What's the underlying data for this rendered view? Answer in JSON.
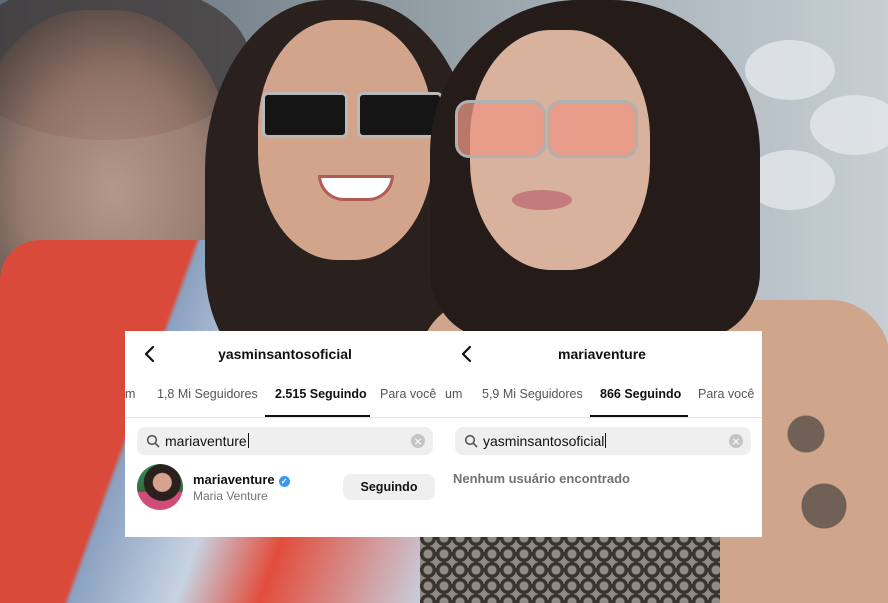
{
  "left_panel": {
    "username": "yasminsantosoficial",
    "tabs": [
      "m",
      "1,8 Mi Seguidores",
      "2.515 Seguindo",
      "Para você"
    ],
    "search_value": "mariaventure",
    "result": {
      "username": "mariaventure",
      "full_name": "Maria Venture",
      "button_label": "Seguindo",
      "verified_icon": "✓"
    }
  },
  "right_panel": {
    "username": "mariaventure",
    "tabs": [
      "um",
      "5,9 Mi Seguidores",
      "866 Seguindo",
      "Para você"
    ],
    "search_value": "yasminsantosoficial",
    "empty_message": "Nenhum usuário encontrado"
  },
  "icons": {
    "back": "chevron-left-icon",
    "search": "search-icon",
    "clear": "clear-icon",
    "verified": "verified-badge-icon"
  },
  "colors": {
    "verified_blue": "#3897f0",
    "active_tab": "#111111",
    "inactive_tab": "#555555"
  }
}
